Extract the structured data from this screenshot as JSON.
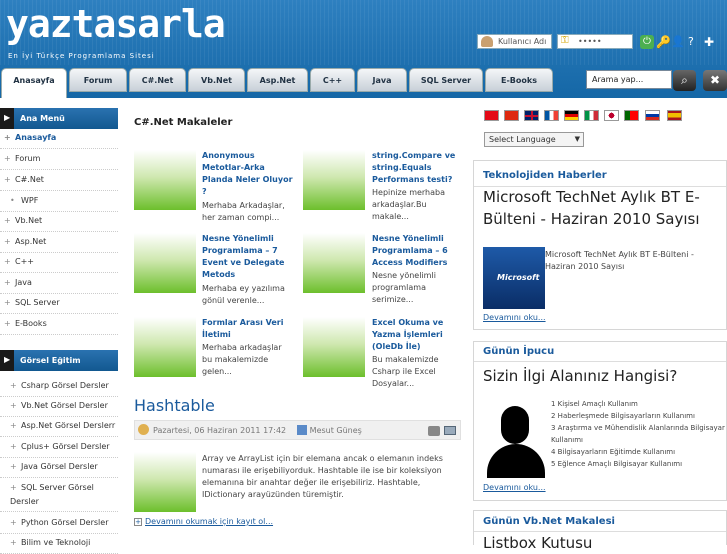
{
  "header": {
    "logo": "yaztasarla",
    "slogan": "En İyi Türkçe Programlama Sitesi",
    "username_placeholder": "Kullanıcı Adı",
    "password_mask": "•••••"
  },
  "nav": {
    "tabs": [
      "Anasayfa",
      "Forum",
      "C#.Net",
      "Vb.Net",
      "Asp.Net",
      "C++",
      "Java",
      "SQL Server",
      "E-Books"
    ],
    "search_placeholder": "Arama yap..."
  },
  "sidebar": {
    "main_title": "Ana Menü",
    "main_items": [
      "Anasayfa",
      "Forum",
      "C#.Net",
      "WPF",
      "Vb.Net",
      "Asp.Net",
      "C++",
      "Java",
      "SQL Server",
      "E-Books"
    ],
    "visual_title": "Görsel Eğitim",
    "visual_items": [
      "Csharp Görsel Dersler",
      "Vb.Net Görsel Dersler",
      "Asp.Net Görsel Derslerr",
      "Cplus+ Görsel Dersler",
      "Java Görsel Dersler",
      "SQL Server Görsel Dersler",
      "Python Görsel Dersler",
      "Bilim ve Teknoloji"
    ]
  },
  "main": {
    "title": "C#.Net Makaleler",
    "articles": [
      {
        "title": "Anonymous Metotlar-Arka Planda Neler Oluyor ?",
        "desc": "Merhaba Arkadaşlar, her zaman compi..."
      },
      {
        "title": "string.Compare ve string.Equals Performans testi?",
        "desc": "Hepinize merhaba arkadaşlar.Bu makale..."
      },
      {
        "title": "Nesne Yönelimli Programlama – 7 Event ve Delegate Metods",
        "desc": "Merhaba ey yazılıma gönül verenle..."
      },
      {
        "title": "Nesne Yönelimli Programlama – 6 Access Modifiers",
        "desc": "Nesne yönelimli programlama serimize..."
      },
      {
        "title": "Formlar Arası Veri İletimi",
        "desc": "Merhaba arkadaşlar bu makalemizde gelen..."
      },
      {
        "title": "Excel Okuma ve Yazma İşlemleri (OleDb İle)",
        "desc": "Bu makalemizde Csharp ile Excel Dosyalar..."
      }
    ],
    "post_title": "Hashtable",
    "post_meta": "Pazartesi, 06 Haziran 2011 17:42",
    "post_author": "Mesut Güneş",
    "post_text": "Array ve ArrayList için bir elemana ancak o elemanın indeks numarası ile erişebiliyorduk. Hashtable ile ise bir koleksiyon elemanına bir anahtar değer ile erişebiliriz. Hashtable, IDictionary arayüzünden türemiştir.",
    "read_more": "Devamını okumak için kayıt ol..."
  },
  "right": {
    "language": "Select Language",
    "news": {
      "heading": "Teknolojiden Haberler",
      "title": "Microsoft TechNet Aylık BT E-Bülteni - Haziran 2010 Sayısı",
      "desc": "Microsoft TechNet Aylık BT E-Bülteni - Haziran 2010 Sayısı",
      "more": "Devamını oku...",
      "logo": "Microsoft"
    },
    "tip": {
      "heading": "Günün İpucu",
      "title": "Sizin İlgi Alanınız Hangisi?",
      "items": [
        "1 Kişisel Amaçlı Kullanım",
        "2 Haberleşmede Bilgisayarların Kullanımı",
        "3 Araştırma ve Mühendislik Alanlarında Bilgisayar Kullanımı",
        "4 Bilgisayarların Eğitimde Kullanımı",
        "5 Eğlence Amaçlı Bilgisayar Kullanımı"
      ],
      "more": "Devamını oku..."
    },
    "vb": {
      "heading": "Günün Vb.Net Makalesi",
      "title": "Listbox Kutusu"
    }
  },
  "colors": {
    "brand": "#1567a6",
    "link": "#1a5a9c",
    "thumb": "#6cbf2c"
  }
}
